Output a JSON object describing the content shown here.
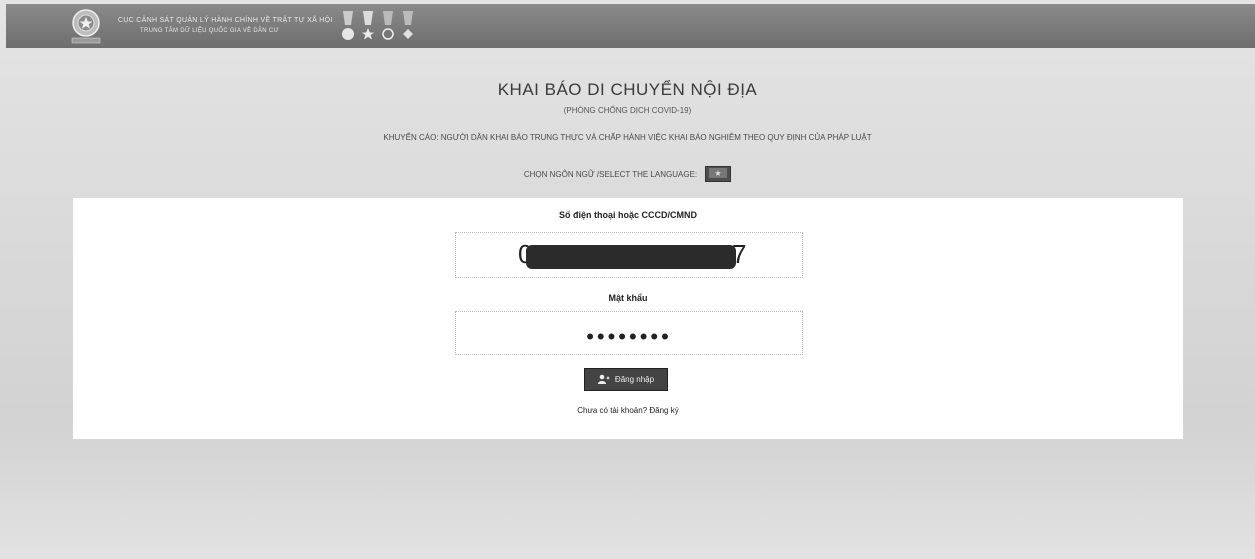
{
  "header": {
    "emblem_icon": "police-emblem-icon",
    "agency_line1": "CỤC CẢNH SÁT QUẢN LÝ HÀNH CHÍNH VỀ TRẬT TỰ XÃ HỘI",
    "agency_line2": "TRUNG TÂM DỮ LIỆU QUỐC GIA VỀ DÂN CƯ",
    "medals": [
      "medal-icon",
      "medal-icon",
      "medal-icon",
      "medal-icon"
    ]
  },
  "page": {
    "title": "KHAI BÁO DI CHUYỂN NỘI ĐỊA",
    "subtitle": "(PHÒNG CHỐNG DỊCH COVID-19)",
    "warning": "KHUYẾN CÁO: NGƯỜI DÂN KHAI BÁO TRUNG THỰC VÀ CHẤP HÀNH VIỆC KHAI BÁO NGHIÊM THEO QUY ĐỊNH CỦA PHÁP LUẬT",
    "language_label": "CHỌN NGÔN NGỮ /SELECT THE LANGUAGE:",
    "language_icon": "flag-icon"
  },
  "form": {
    "username_label": "Số điện thoại hoặc CCCD/CMND",
    "username_value_start": "0",
    "username_value_end": "7",
    "password_label": "Mật khẩu",
    "password_value": "••••••••",
    "login_label": "Đăng nhập",
    "login_icon": "user-plus-icon",
    "signup_text": "Chưa có tài khoản? Đăng ký"
  }
}
